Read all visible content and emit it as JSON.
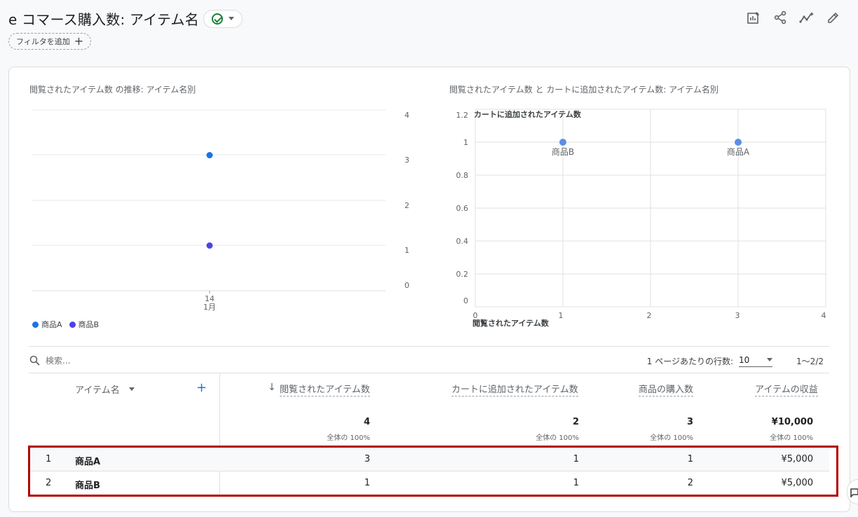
{
  "header": {
    "title": "e コマース購入数: アイテム名",
    "filter_label": "フィルタを追加",
    "filter_plus": "+"
  },
  "icons": [
    "customize-report-icon",
    "share-icon",
    "insights-icon",
    "edit-icon",
    "search-icon",
    "feedback-icon"
  ],
  "colors": {
    "series_a": "#1a73e8",
    "series_b": "#4c44e4",
    "scatter_point": "#5b8fe6",
    "highlight": "#b20000",
    "check": "#188038"
  },
  "line_chart": {
    "title": "閲覧されたアイテム数 の推移: アイテム名別",
    "y_ticks": [
      "4",
      "3",
      "2",
      "1",
      "0"
    ],
    "x_tick_day": "14",
    "x_tick_month": "1月",
    "legend": [
      {
        "label": "商品A"
      },
      {
        "label": "商品B"
      }
    ]
  },
  "scatter_chart": {
    "title": "閲覧されたアイテム数 と カートに追加されたアイテム数: アイテム名別",
    "y_label": "カートに追加されたアイテム数",
    "x_label": "閲覧されたアイテム数",
    "y_ticks": [
      "1.2",
      "1",
      "0.8",
      "0.6",
      "0.4",
      "0.2",
      "0"
    ],
    "x_ticks": [
      "0",
      "1",
      "2",
      "3",
      "4"
    ],
    "point_labels": [
      "商品B",
      "商品A"
    ]
  },
  "chart_data": [
    {
      "type": "line",
      "title": "閲覧されたアイテム数 の推移: アイテム名別",
      "x": [
        "1月14"
      ],
      "series": [
        {
          "name": "商品A",
          "values": [
            3
          ]
        },
        {
          "name": "商品B",
          "values": [
            1
          ]
        }
      ],
      "ylim": [
        0,
        4
      ],
      "grid": true,
      "legend_position": "bottom-left"
    },
    {
      "type": "scatter",
      "title": "閲覧されたアイテム数 と カートに追加されたアイテム数: アイテム名別",
      "xlabel": "閲覧されたアイテム数",
      "ylabel": "カートに追加されたアイテム数",
      "points": [
        {
          "label": "商品B",
          "x": 1,
          "y": 1
        },
        {
          "label": "商品A",
          "x": 3,
          "y": 1
        }
      ],
      "xlim": [
        0,
        4
      ],
      "ylim": [
        0,
        1.2
      ],
      "grid": true
    }
  ],
  "table": {
    "search_placeholder": "検索...",
    "rows_per_page_label": "1 ページあたりの行数:",
    "rows_per_page_value": "10",
    "page_range": "1〜2/2",
    "headers": {
      "item_name": "アイテム名",
      "views": "閲覧されたアイテム数",
      "add_to_cart": "カートに追加されたアイテム数",
      "purchases": "商品の購入数",
      "revenue": "アイテムの収益"
    },
    "sort_arrow": "↓",
    "add_dim": "+",
    "totals": {
      "views": "4",
      "add_to_cart": "2",
      "purchases": "3",
      "revenue": "¥10,000",
      "views_pct": "全体の 100%",
      "add_to_cart_pct": "全体の 100%",
      "purchases_pct": "全体の 100%",
      "revenue_pct": "全体の 100%"
    },
    "rows": [
      {
        "index": "1",
        "name": "商品A",
        "views": "3",
        "add_to_cart": "1",
        "purchases": "1",
        "revenue": "¥5,000"
      },
      {
        "index": "2",
        "name": "商品B",
        "views": "1",
        "add_to_cart": "1",
        "purchases": "2",
        "revenue": "¥5,000"
      }
    ]
  }
}
